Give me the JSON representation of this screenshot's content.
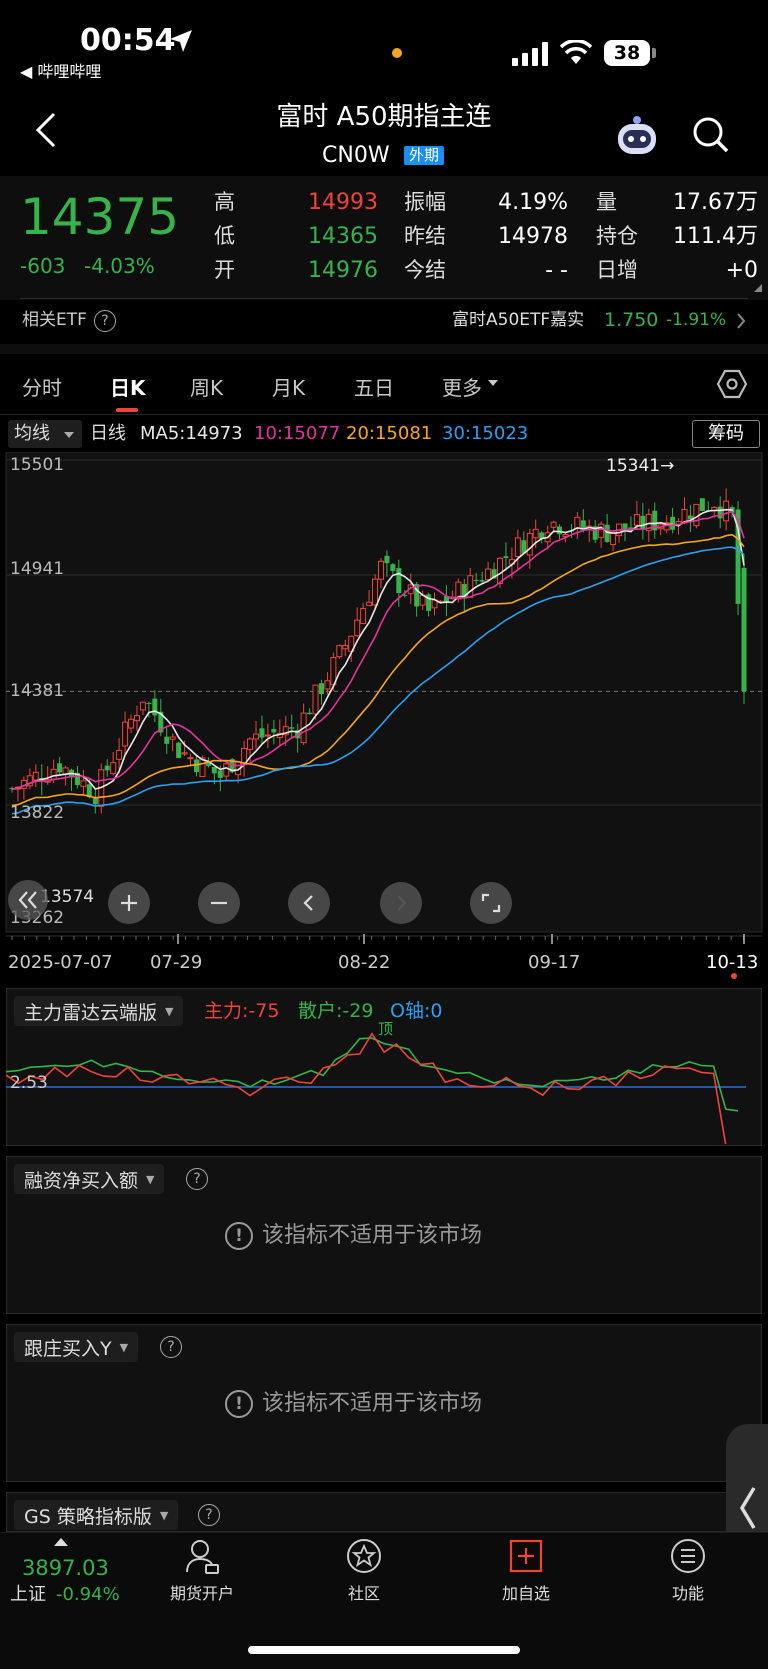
{
  "status_bar": {
    "time": "00:54",
    "back_app": "◀ 哔哩哔哩",
    "battery": "38"
  },
  "header": {
    "title": "富时 A50期指主连",
    "code": "CN0W",
    "badge": "外期"
  },
  "quote": {
    "price": "14375",
    "change": "-603",
    "change_pct": "-4.03%",
    "rows": [
      {
        "label": "高",
        "value": "14993",
        "label2": "振幅",
        "value2": "4.19%",
        "label3": "量",
        "value3": "17.67万"
      },
      {
        "label": "低",
        "value": "14365",
        "label2": "昨结",
        "value2": "14978",
        "label3": "持仓",
        "value3": "111.4万"
      },
      {
        "label": "开",
        "value": "14976",
        "label2": "今结",
        "value2": "- -",
        "label3": "日增",
        "value3": "+0"
      }
    ]
  },
  "etf": {
    "label": "相关ETF",
    "name": "富时A50ETF嘉实",
    "price": "1.750",
    "change": "-1.91%"
  },
  "tabs": [
    "分时",
    "日K",
    "周K",
    "月K",
    "五日",
    "更多"
  ],
  "active_tab": "日K",
  "ma_bar": {
    "selector": "均线",
    "period": "日线",
    "ma5": "MA5:14973",
    "ma10": "10:15077",
    "ma20": "20:15081",
    "ma30": "30:15023",
    "chip_button": "筹码"
  },
  "chart_data": {
    "type": "candlestick",
    "y_ticks": [
      "15501",
      "14941",
      "14381",
      "13822",
      "13574",
      "13262"
    ],
    "ylim": [
      13262,
      15501
    ],
    "max_marker": "15341→",
    "x_labels": [
      "2025-07-07",
      "07-29",
      "08-22",
      "09-17",
      "10-13"
    ],
    "last_close": 14375,
    "colors": {
      "up": "#f0443a",
      "down": "#36b34a",
      "ma5": "#e8e8e8",
      "ma10": "#e0359a",
      "ma20": "#f5a623",
      "ma30": "#2f9ff0"
    }
  },
  "indicator": {
    "name": "主力雷达云端版",
    "main": "主力:-75",
    "retail": "散户:-29",
    "axis": "O轴:0",
    "top_label": "顶",
    "level": "2.53"
  },
  "panels": [
    {
      "name": "融资净买入额",
      "message": "该指标不适用于该市场"
    },
    {
      "name": "跟庄买入Y",
      "message": "该指标不适用于该市场"
    }
  ],
  "gs_panel": {
    "name": "GS 策略指标版"
  },
  "bottom_nav": {
    "index_value": "3897.03",
    "index_name": "上证",
    "index_change": "-0.94%",
    "items": [
      "期货开户",
      "社区",
      "加自选",
      "功能"
    ]
  }
}
